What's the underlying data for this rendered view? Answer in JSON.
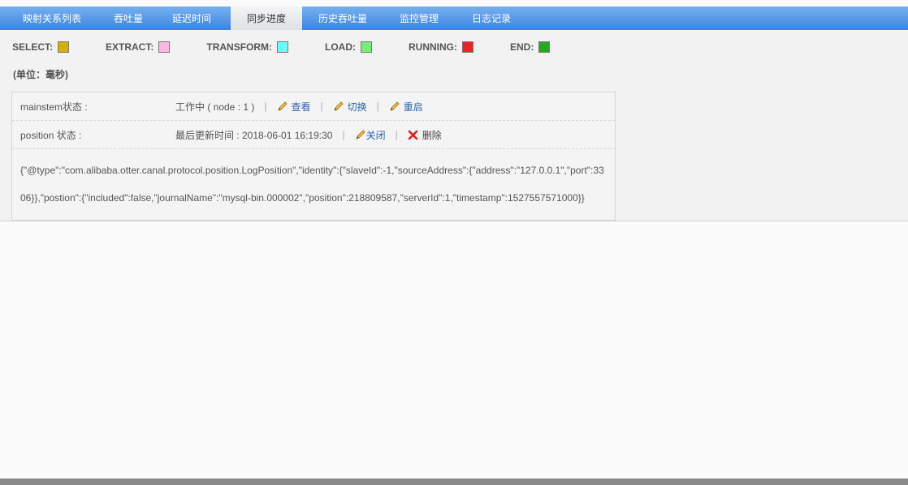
{
  "tabs": [
    {
      "label": "映射关系列表",
      "active": false
    },
    {
      "label": "吞吐量",
      "active": false
    },
    {
      "label": "延迟时间",
      "active": false
    },
    {
      "label": "同步进度",
      "active": true
    },
    {
      "label": "历史吞吐量",
      "active": false
    },
    {
      "label": "监控管理",
      "active": false
    },
    {
      "label": "日志记录",
      "active": false
    }
  ],
  "legend": [
    {
      "label": "SELECT:",
      "color": "#d4b000"
    },
    {
      "label": "EXTRACT:",
      "color": "#ffb6e0"
    },
    {
      "label": "TRANSFORM:",
      "color": "#66ffff"
    },
    {
      "label": "LOAD:",
      "color": "#77ee77"
    },
    {
      "label": "RUNNING:",
      "color": "#ee2222"
    },
    {
      "label": "END:",
      "color": "#22aa22"
    }
  ],
  "unit_label": "(单位：毫秒)",
  "mainstem": {
    "label": "mainstem状态 :",
    "value": "工作中 ( node : 1 )",
    "sep": "|",
    "view": "查看",
    "switch": "切换",
    "restart": "重启"
  },
  "position": {
    "label": "position 状态 :",
    "value": "最后更新时间 : 2018-06-01 16:19:30",
    "sep": "|",
    "close": "关闭",
    "delete": "删除"
  },
  "position_json": "{\"@type\":\"com.alibaba.otter.canal.protocol.position.LogPosition\",\"identity\":{\"slaveId\":-1,\"sourceAddress\":{\"address\":\"127.0.0.1\",\"port\":3306}},\"postion\":{\"included\":false,\"journalName\":\"mysql-bin.000002\",\"position\":218809587,\"serverId\":1,\"timestamp\":1527557571000}}",
  "colors": {
    "nav_top": "#76b0f0",
    "nav_bottom": "#3c83df",
    "link": "#2b63b0",
    "delete": "#dd2222"
  }
}
